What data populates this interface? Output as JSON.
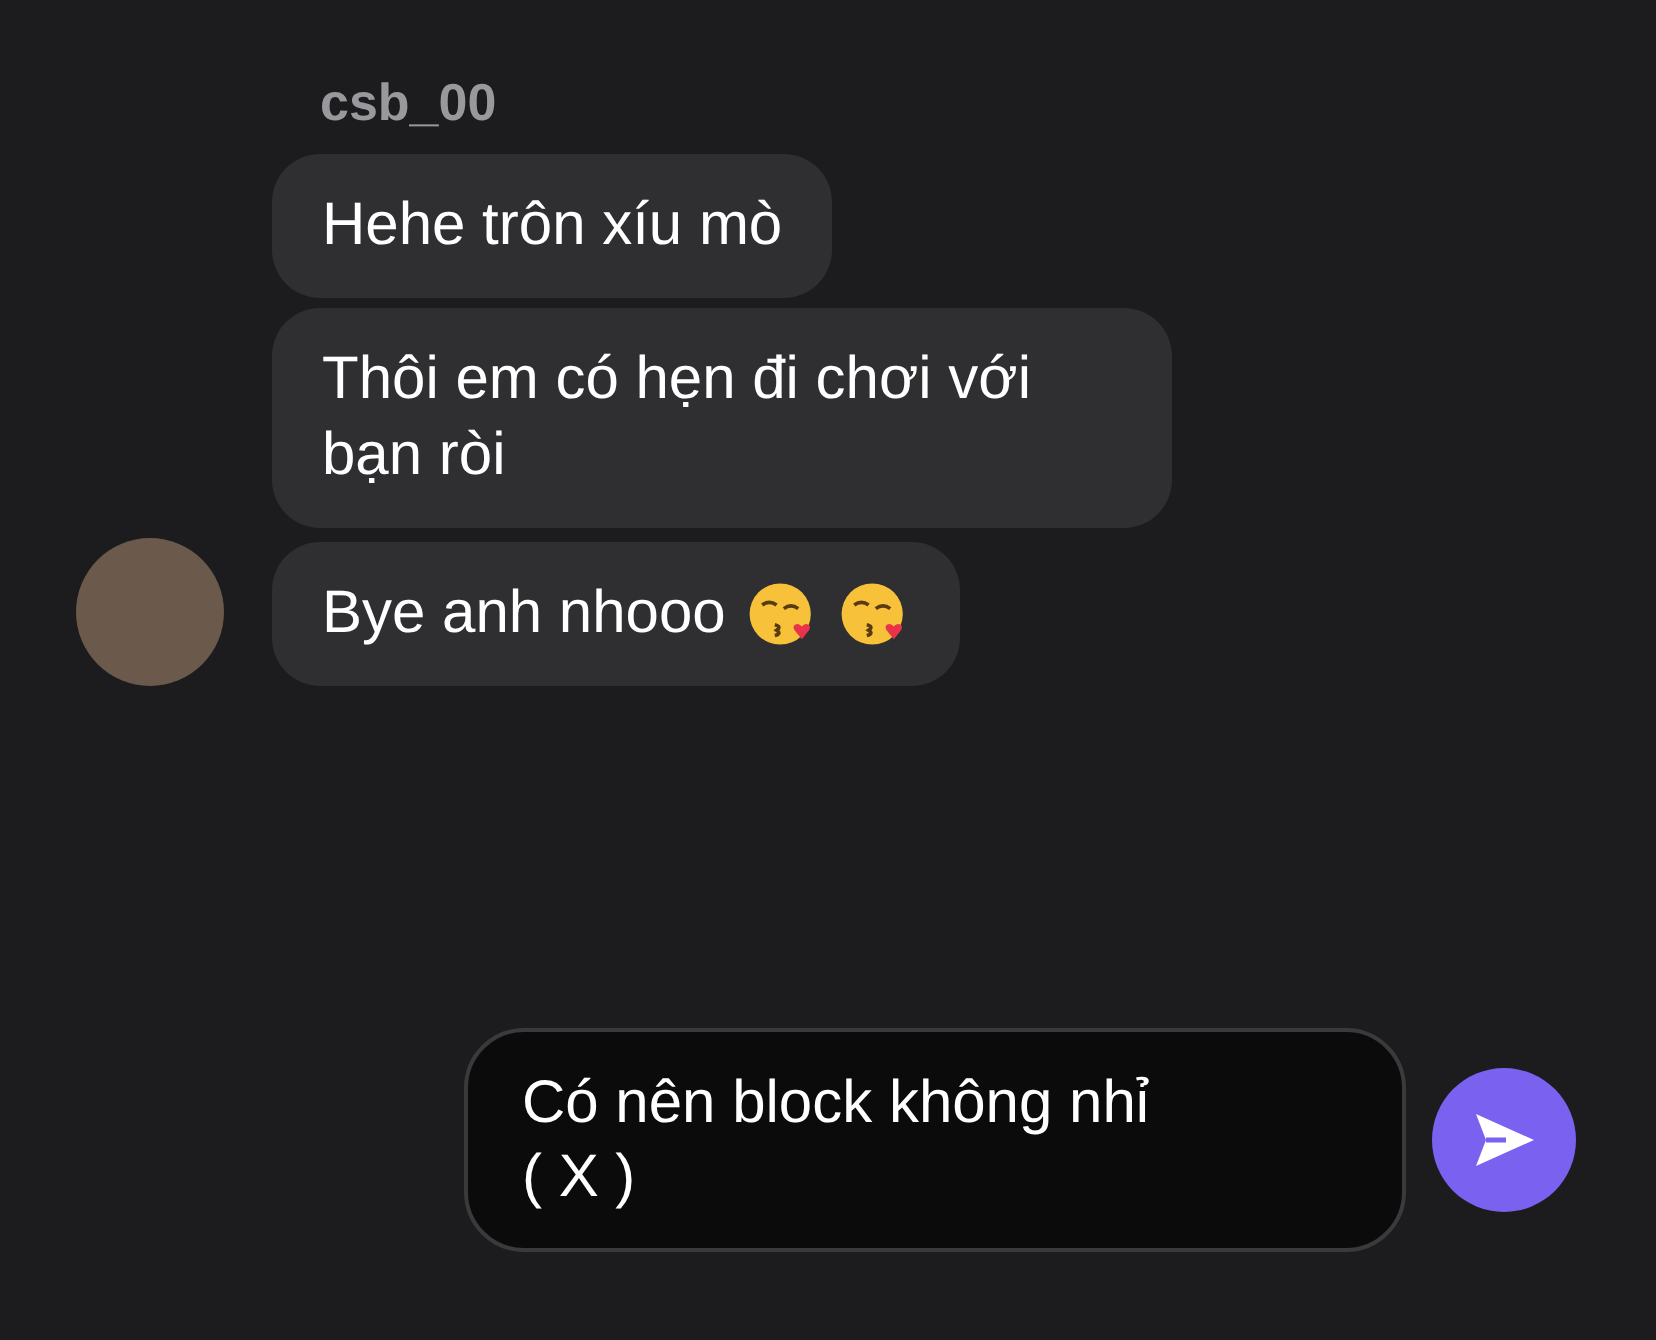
{
  "sender": {
    "name": "csb_00"
  },
  "messages": [
    {
      "text": "Hehe trôn xíu mò",
      "avatar": false
    },
    {
      "text": "Thôi em có hẹn đi chơi với bạn ròi",
      "avatar": false
    },
    {
      "text": "Bye anh nhooo",
      "avatar": true,
      "emojis": [
        {
          "kind": "kiss"
        },
        {
          "kind": "kiss"
        }
      ]
    }
  ],
  "composer": {
    "value": "Có nên block không nhỉ\n( X )"
  }
}
